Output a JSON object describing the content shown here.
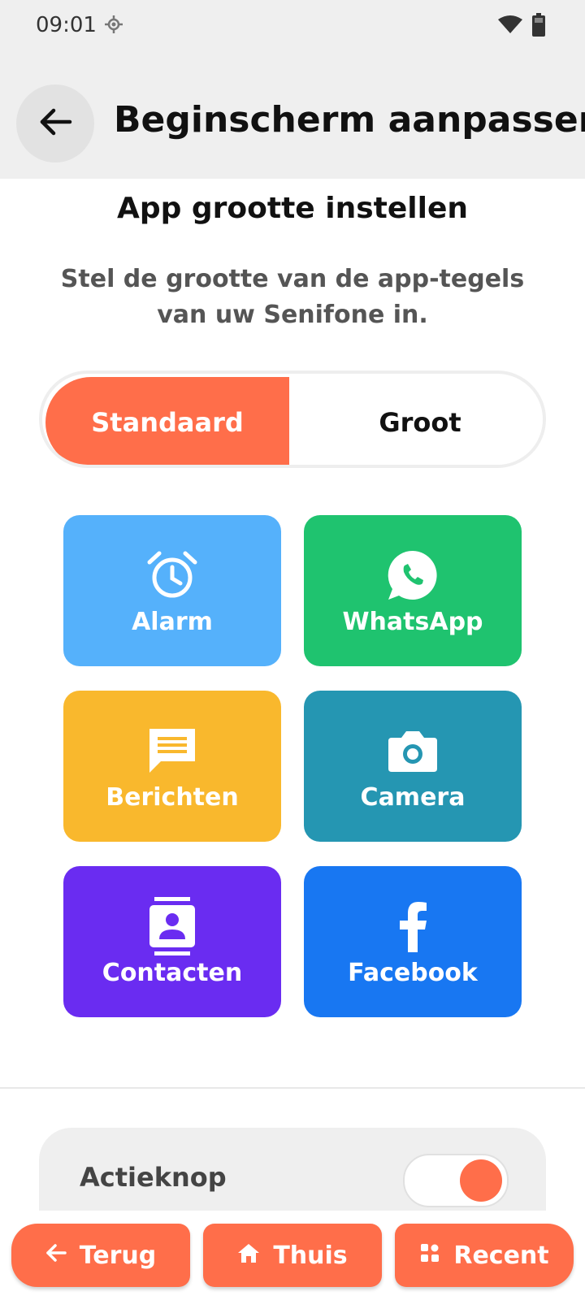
{
  "status_bar": {
    "time": "09:01",
    "icons": [
      "location-icon",
      "wifi-icon",
      "battery-icon"
    ]
  },
  "header": {
    "back_icon": "arrow-left-icon",
    "title": "Beginscherm aanpassen"
  },
  "section": {
    "title": "App grootte instellen",
    "description": "Stel de grootte van de app-tegels van uw Senifone in."
  },
  "size_toggle": {
    "options": [
      "Standaard",
      "Groot"
    ],
    "selected": "Standaard",
    "selected_color": "#ff6e4a"
  },
  "tiles": [
    {
      "label": "Alarm",
      "icon": "alarm-clock-icon",
      "color": "#55b1fb"
    },
    {
      "label": "WhatsApp",
      "icon": "whatsapp-icon",
      "color": "#1fc36f"
    },
    {
      "label": "Berichten",
      "icon": "message-icon",
      "color": "#f9b82d"
    },
    {
      "label": "Camera",
      "icon": "camera-icon",
      "color": "#2596b2"
    },
    {
      "label": "Contacten",
      "icon": "contact-icon",
      "color": "#6a2cf1"
    },
    {
      "label": "Facebook",
      "icon": "facebook-icon",
      "color": "#1877f2"
    }
  ],
  "action_button": {
    "label": "Actieknop",
    "enabled": true
  },
  "bottom_nav": {
    "back": {
      "label": "Terug",
      "icon": "arrow-left-icon"
    },
    "home": {
      "label": "Thuis",
      "icon": "home-icon"
    },
    "recent": {
      "label": "Recent",
      "icon": "recent-apps-icon"
    }
  }
}
